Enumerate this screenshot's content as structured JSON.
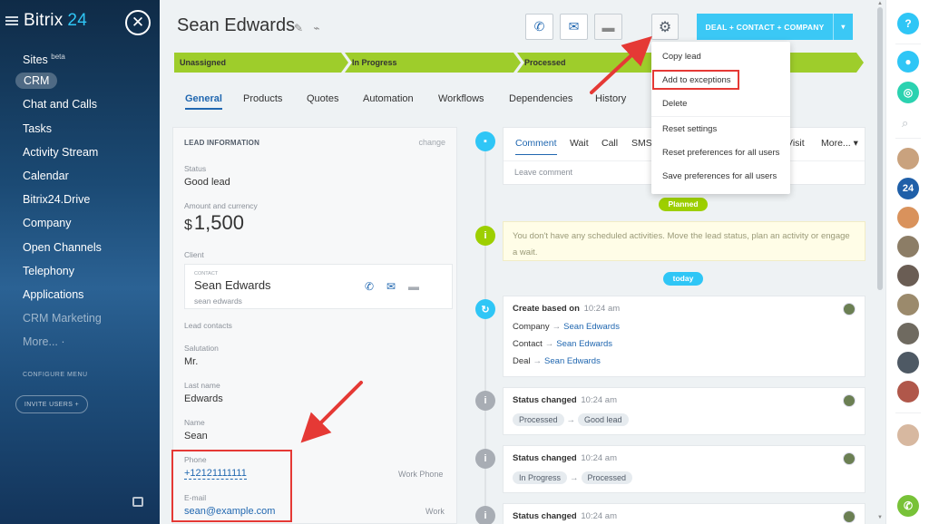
{
  "sidebar": {
    "logo_text": "Bitrix",
    "logo_num": "24",
    "close_symbol": "✕",
    "items": [
      {
        "label": "Sites",
        "sup": "beta"
      },
      {
        "label": "CRM"
      },
      {
        "label": "Chat and Calls"
      },
      {
        "label": "Tasks"
      },
      {
        "label": "Activity Stream"
      },
      {
        "label": "Calendar"
      },
      {
        "label": "Bitrix24.Drive"
      },
      {
        "label": "Company"
      },
      {
        "label": "Open Channels"
      },
      {
        "label": "Telephony"
      },
      {
        "label": "Applications"
      },
      {
        "label": "CRM Marketing"
      },
      {
        "label": "More... ·"
      }
    ],
    "configure": "CONFIGURE MENU",
    "invite": "INVITE USERS +"
  },
  "header": {
    "title": "Sean Edwards",
    "edit_icon": "✎",
    "link_icon": "⌁",
    "call_icon": "✆",
    "mail_icon": "✉",
    "chat_icon": "▬",
    "gear_icon": "⚙",
    "deal_button": "DEAL + CONTACT + COMPANY",
    "caret": "▾"
  },
  "stages": [
    "Unassigned",
    "In Progress",
    "Processed",
    "",
    ""
  ],
  "tabs": [
    "General",
    "Products",
    "Quotes",
    "Automation",
    "Workflows",
    "Dependencies",
    "History"
  ],
  "lead": {
    "heading": "LEAD INFORMATION",
    "change": "change",
    "status_label": "Status",
    "status_value": "Good lead",
    "amount_label": "Amount and currency",
    "amount_currency": "$",
    "amount_value": "1,500",
    "client_label": "Client",
    "client_contact_label": "CONTACT",
    "client_name": "Sean Edwards",
    "client_sub": "sean edwards",
    "lead_contacts": "Lead contacts",
    "salutation_label": "Salutation",
    "salutation_value": "Mr.",
    "lastname_label": "Last name",
    "lastname_value": "Edwards",
    "name_label": "Name",
    "name_value": "Sean",
    "phone_label": "Phone",
    "phone_value": "+12121111111",
    "phone_type": "Work Phone",
    "email_label": "E-mail",
    "email_value": "sean@example.com",
    "email_type": "Work"
  },
  "editor": {
    "tabs": [
      "Comment",
      "Wait",
      "Call",
      "SMS"
    ],
    "visit": "Visit",
    "more": "More... ▾",
    "placeholder": "Leave comment"
  },
  "timeline": {
    "planned": "Planned",
    "note": "You don't have any scheduled activities. Move the lead status, plan an activity or engage a wait.",
    "today": "today",
    "created": {
      "title": "Create based on",
      "time": "10:24 am",
      "rows": [
        {
          "label": "Company",
          "value": "Sean Edwards"
        },
        {
          "label": "Contact",
          "value": "Sean Edwards"
        },
        {
          "label": "Deal",
          "value": "Sean Edwards"
        }
      ]
    },
    "status1": {
      "title": "Status changed",
      "time": "10:24 am",
      "from": "Processed",
      "to": "Good lead"
    },
    "status2": {
      "title": "Status changed",
      "time": "10:24 am",
      "from": "In Progress",
      "to": "Processed"
    },
    "status3": {
      "title": "Status changed",
      "time": "10:24 am"
    }
  },
  "dropdown": {
    "items": [
      "Copy lead",
      "Add to exceptions",
      "Delete",
      "Reset settings",
      "Reset preferences for all users",
      "Save preferences for all users"
    ]
  },
  "rail": {
    "help": "?",
    "bitrix_badge": "24"
  },
  "colors": {
    "accent": "#2067b0",
    "stage": "#9ecd2b",
    "deal_button": "#3bc8f5",
    "highlight": "#e53935"
  }
}
